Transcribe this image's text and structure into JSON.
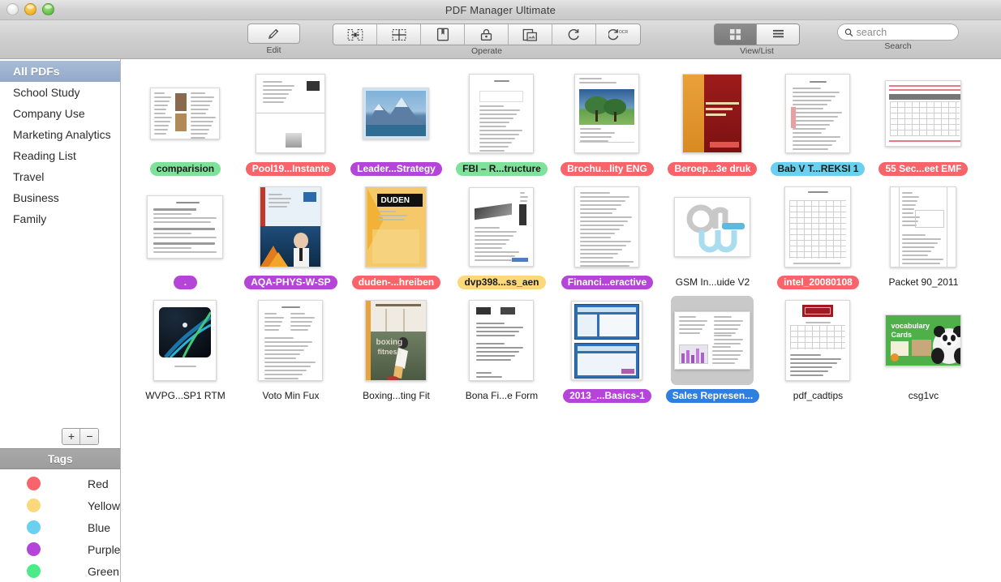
{
  "window": {
    "title": "PDF Manager Ultimate",
    "controls": [
      "close",
      "minimize",
      "maximize"
    ]
  },
  "toolbar": {
    "edit": {
      "label": "Edit",
      "icon": "pencil-icon"
    },
    "operate": {
      "label": "Operate",
      "buttons": [
        {
          "name": "merge",
          "icon": "merge-icon"
        },
        {
          "name": "split",
          "icon": "split-icon"
        },
        {
          "name": "bookmark",
          "icon": "bookmark-icon"
        },
        {
          "name": "encrypt",
          "icon": "lock-icon"
        },
        {
          "name": "watermark",
          "icon": "watermark-icon"
        },
        {
          "name": "convert",
          "icon": "convert-icon"
        },
        {
          "name": "ocr",
          "icon": "ocr-icon"
        }
      ]
    },
    "view_list": {
      "label": "View/List",
      "options": [
        {
          "name": "grid-view",
          "icon": "grid-icon",
          "selected": true
        },
        {
          "name": "list-view",
          "icon": "list-icon",
          "selected": false
        }
      ]
    },
    "search": {
      "label": "Search",
      "placeholder": "search",
      "value": "",
      "icon": "search-icon"
    }
  },
  "sidebar": {
    "sources": [
      {
        "label": "All PDFs",
        "selected": true
      },
      {
        "label": "School Study",
        "selected": false
      },
      {
        "label": "Company Use",
        "selected": false
      },
      {
        "label": "Marketing Analytics",
        "selected": false
      },
      {
        "label": "Reading List",
        "selected": false
      },
      {
        "label": "Travel",
        "selected": false
      },
      {
        "label": "Business",
        "selected": false
      },
      {
        "label": "Family",
        "selected": false
      }
    ],
    "add_button": "+",
    "remove_button": "−",
    "tags_header": "Tags",
    "tags": [
      {
        "label": "Red",
        "color": "#f9646a"
      },
      {
        "label": "Yellow",
        "color": "#fbd97a"
      },
      {
        "label": "Blue",
        "color": "#6ad0ef"
      },
      {
        "label": "Purple",
        "color": "#b545d8"
      },
      {
        "label": "Green",
        "color": "#4ceb8a"
      }
    ]
  },
  "tag_colors": {
    "red": "#f9646a",
    "yellow": "#fbd97a",
    "blue": "#6ad0ef",
    "purple": "#b545d8",
    "green": "#7ee29b",
    "none": "transparent"
  },
  "documents": [
    {
      "label": "comparision",
      "tag": "green",
      "selected": false,
      "thumb": "text-photo-page"
    },
    {
      "label": "Pool19...Instante",
      "tag": "red",
      "selected": false,
      "thumb": "two-page-spread"
    },
    {
      "label": "Leader...Strategy",
      "tag": "purple",
      "selected": false,
      "thumb": "mountain-cover"
    },
    {
      "label": "FBI – R...tructure",
      "tag": "green",
      "selected": false,
      "thumb": "outline-doc"
    },
    {
      "label": "Brochu...lity ENG",
      "tag": "red",
      "selected": false,
      "thumb": "trees-brochure"
    },
    {
      "label": "Beroep...3e druk",
      "tag": "red",
      "selected": false,
      "thumb": "red-book-cover"
    },
    {
      "label": "Bab V T...REKSI 1",
      "tag": "blue",
      "selected": false,
      "thumb": "plain-text-page"
    },
    {
      "label": "55 Sec...eet EMF",
      "tag": "red",
      "selected": false,
      "thumb": "red-spreadsheet"
    },
    {
      "label": ".",
      "tag": "purple",
      "selected": false,
      "thumb": "form-doc"
    },
    {
      "label": "AQA-PHYS-W-SP",
      "tag": "purple",
      "selected": false,
      "thumb": "physics-cover"
    },
    {
      "label": "duden-...hreiben",
      "tag": "red",
      "selected": false,
      "thumb": "duden-cover"
    },
    {
      "label": "dvp398...ss_aen",
      "tag": "yellow",
      "selected": false,
      "thumb": "device-datasheet"
    },
    {
      "label": "Financi...eractive",
      "tag": "purple",
      "selected": false,
      "thumb": "dense-text-page"
    },
    {
      "label": "GSM In...uide V2",
      "tag": "none",
      "selected": false,
      "thumb": "on-logo-cover"
    },
    {
      "label": "intel_20080108",
      "tag": "red",
      "selected": false,
      "thumb": "intel-table"
    },
    {
      "label": "Packet 90_2011",
      "tag": "none",
      "selected": false,
      "thumb": "scan-form"
    },
    {
      "label": "WVPG...SP1 RTM",
      "tag": "none",
      "selected": false,
      "thumb": "dark-tech-cover"
    },
    {
      "label": "Voto Min Fux",
      "tag": "none",
      "selected": false,
      "thumb": "letter-page"
    },
    {
      "label": "Boxing...ting Fit",
      "tag": "none",
      "selected": false,
      "thumb": "boxing-cover"
    },
    {
      "label": "Bona Fi...e Form",
      "tag": "none",
      "selected": false,
      "thumb": "handwriting-page"
    },
    {
      "label": "2013_...Basics-1",
      "tag": "purple",
      "selected": false,
      "thumb": "screenshot-pair"
    },
    {
      "label": "Sales Represen...",
      "tag": "none",
      "selected": true,
      "thumb": "sales-report"
    },
    {
      "label": "pdf_cadtips",
      "tag": "none",
      "selected": false,
      "thumb": "cadtips-page"
    },
    {
      "label": "csg1vc",
      "tag": "none",
      "selected": false,
      "thumb": "panda-card"
    }
  ]
}
